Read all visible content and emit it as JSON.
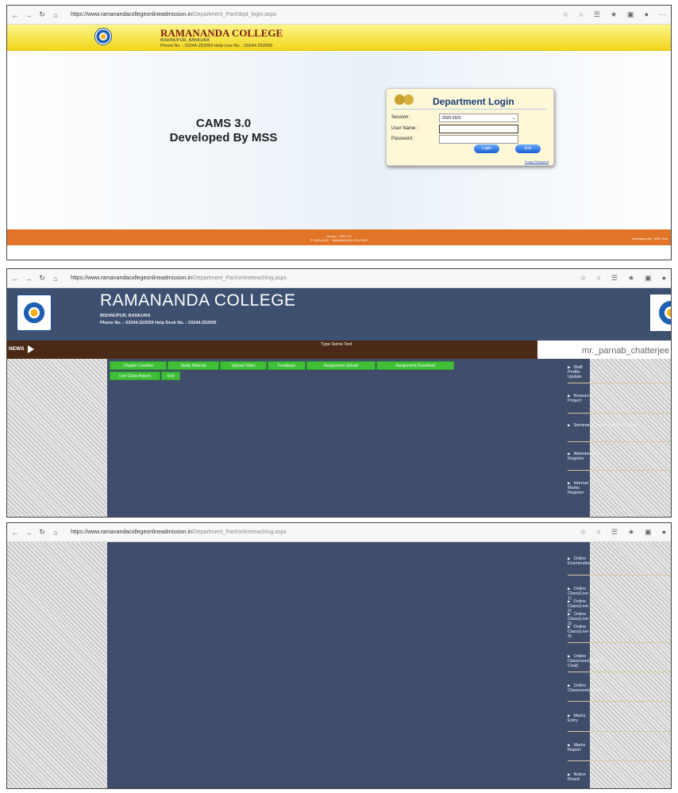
{
  "browser": {
    "nav_icons": [
      "←",
      "→",
      "↻",
      "⌂"
    ],
    "lock_icon": "🔒",
    "right_icons": [
      "☆",
      "○",
      "☰",
      "★",
      "▣",
      "●",
      "⋯"
    ],
    "url1_host": "https://www.ramanandacollegeonlineadmission.in",
    "url1_path": "/Department_Part/dept_login.aspx",
    "url2_host": "https://www.ramanandacollegeonlineadmission.in",
    "url2_path": "/Department_Part/onlineteaching.aspx",
    "url3_host": "https://www.ramanandacollegeonlineadmission.in",
    "url3_path": "/Department_Part/onlineteaching.aspx"
  },
  "login_page": {
    "college": "RAMANANDA COLLEGE",
    "address": "BISHNUPUR, BANKURA",
    "phone": "Phone No. : 03244-252059   Help Line No. : 03244-252059",
    "cams_line1": "CAMS 3.0",
    "cams_line2": "Developed By MSS",
    "login_title": "Department Login",
    "session_label": "Session:",
    "session_value": "2020-2021",
    "username_label": "User Name :",
    "password_label": "Password :",
    "login_btn": "Login",
    "exit_btn": "Exit",
    "forgot": "Forgot Password",
    "footer_version": "Version : ERP 3.0",
    "footer_copy": "© 2020-2021 · RAMANANDA COLLEGE",
    "footer_dev": "Developed By : MSS Soft"
  },
  "teach_page": {
    "college": "RAMANANDA COLLEGE",
    "address": "BISHNUPUR, BANKURA",
    "phone": "Phone No. : 03244-252059    Help Desk No. : 03244-252059",
    "news_label": "NEWS",
    "news_text": "Type Some Text",
    "username": "mr._parnab_chatterjee",
    "menu": [
      "Chapter Creation",
      "Study Material",
      "Upload Video",
      "Feedback",
      "Assignment Upload",
      "Assignment Download",
      "Live Class Report",
      "Exit"
    ],
    "side": [
      "Staff Profile Update",
      "Research Project",
      "Seminars/Conference/Workshop",
      "Attendance Register",
      "Internal Marks Register"
    ]
  },
  "teach_page_scrolled": {
    "side": [
      "Online Examination",
      "Online Class(Live-1)",
      "Online Class(Live-2)",
      "Online Class(Live-3)",
      "Online Class(Live-4)",
      "Online Classroom(Video Chat)",
      "Online Classroom(Audio)",
      "Marks Entry",
      "Marks Report",
      "Notice Board"
    ]
  }
}
